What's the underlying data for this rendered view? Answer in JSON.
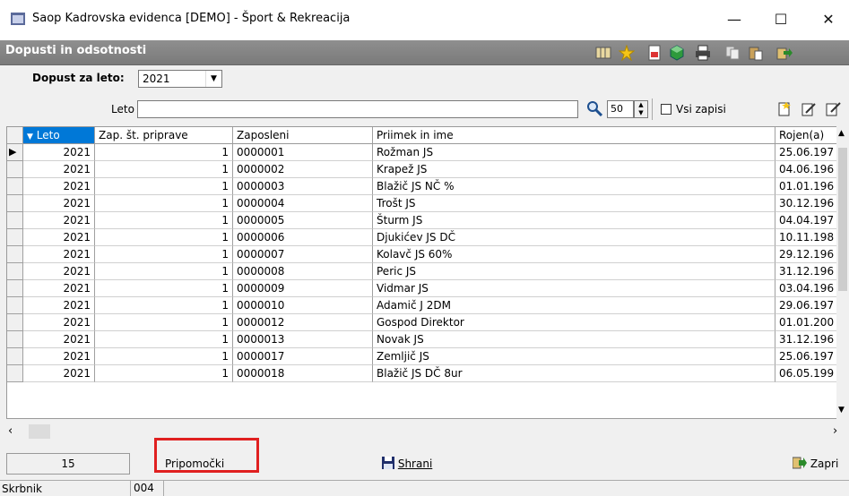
{
  "window": {
    "title": "Saop Kadrovska evidenca [DEMO] - Šport & Rekreacija",
    "minimize": "—",
    "maximize": "☐",
    "close": "✕"
  },
  "panel": {
    "caption": "Dopusti in odsotnosti"
  },
  "filter": {
    "year_label": "Dopust za leto:",
    "year_value": "2021",
    "search_label": "Leto",
    "search_value": "",
    "page_size": "50",
    "all_records_label": "Vsi zapisi",
    "all_records_checked": false
  },
  "grid": {
    "columns": [
      "Leto",
      "Zap. št. priprave",
      "Zaposleni",
      "Priimek in ime",
      "Rojen(a)"
    ],
    "sorted_column": "Leto",
    "rows": [
      [
        "2021",
        "1",
        "0000001",
        "Rožman JS",
        "25.06.197"
      ],
      [
        "2021",
        "1",
        "0000002",
        "Krapež JS",
        "04.06.196"
      ],
      [
        "2021",
        "1",
        "0000003",
        "Blažič JS NČ %",
        "01.01.196"
      ],
      [
        "2021",
        "1",
        "0000004",
        "Trošt JS",
        "30.12.196"
      ],
      [
        "2021",
        "1",
        "0000005",
        "Šturm JS",
        "04.04.197"
      ],
      [
        "2021",
        "1",
        "0000006",
        "Djukićev JS DČ",
        "10.11.198"
      ],
      [
        "2021",
        "1",
        "0000007",
        "Kolavč JS 60%",
        "29.12.196"
      ],
      [
        "2021",
        "1",
        "0000008",
        "Peric JS",
        "31.12.196"
      ],
      [
        "2021",
        "1",
        "0000009",
        "Vidmar JS",
        "03.04.196"
      ],
      [
        "2021",
        "1",
        "0000010",
        "Adamič J 2DM",
        "29.06.197"
      ],
      [
        "2021",
        "1",
        "0000012",
        "Gospod Direktor",
        "01.01.200"
      ],
      [
        "2021",
        "1",
        "0000013",
        "Novak JS",
        "31.12.196"
      ],
      [
        "2021",
        "1",
        "0000017",
        "Zemljič JS",
        "25.06.197"
      ],
      [
        "2021",
        "1",
        "0000018",
        "Blažič JS DČ 8ur",
        "06.05.199"
      ]
    ]
  },
  "footer": {
    "record_count": "15",
    "tools_label": "Pripomočki",
    "save_label": "Shrani",
    "close_label": "Zapri"
  },
  "statusbar": {
    "user": "Skrbnik",
    "code": "004"
  },
  "colors": {
    "selected_header": "#0078d7",
    "highlight": "#e02020",
    "caption_bar": "#808080"
  }
}
